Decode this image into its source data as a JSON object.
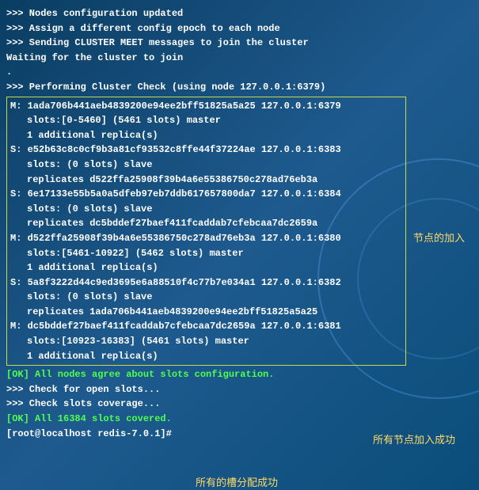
{
  "header": {
    "line1": ">>> Nodes configuration updated",
    "line2": ">>> Assign a different config epoch to each node",
    "line3": ">>> Sending CLUSTER MEET messages to join the cluster",
    "line4": "Waiting for the cluster to join",
    "blank": ".",
    "line5": ">>> Performing Cluster Check (using node 127.0.0.1:6379)"
  },
  "nodes": {
    "n1": {
      "head": "M: 1ada706b441aeb4839200e94ee2bff51825a5a25 127.0.0.1:6379",
      "slots": "slots:[0-5460] (5461 slots) master",
      "extra": "1 additional replica(s)"
    },
    "n2": {
      "head": "S: e52b63c8c0cf9b3a81cf93532c8ffe44f37224ae 127.0.0.1:6383",
      "slots": "slots: (0 slots) slave",
      "extra": "replicates d522ffa25908f39b4a6e55386750c278ad76eb3a"
    },
    "n3": {
      "head": "S: 6e17133e55b5a0a5dfeb97eb7ddb617657800da7 127.0.0.1:6384",
      "slots": "slots: (0 slots) slave",
      "extra": "replicates dc5bddef27baef411fcaddab7cfebcaa7dc2659a"
    },
    "n4": {
      "head": "M: d522ffa25908f39b4a6e55386750c278ad76eb3a 127.0.0.1:6380",
      "slots": "slots:[5461-10922] (5462 slots) master",
      "extra": "1 additional replica(s)"
    },
    "n5": {
      "head": "S: 5a8f3222d44c9ed3695e6a88510f4c77b7e034a1 127.0.0.1:6382",
      "slots": "slots: (0 slots) slave",
      "extra": "replicates 1ada706b441aeb4839200e94ee2bff51825a5a25"
    },
    "n6": {
      "head": "M: dc5bddef27baef411fcaddab7cfebcaa7dc2659a 127.0.0.1:6381",
      "slots": "slots:[10923-16383] (5461 slots) master",
      "extra": "1 additional replica(s)"
    }
  },
  "footer": {
    "ok1": "[OK] All nodes agree about slots configuration.",
    "check1": ">>> Check for open slots...",
    "check2": ">>> Check slots coverage...",
    "ok2": "[OK] All 16384 slots covered.",
    "prompt": "[root@localhost redis-7.0.1]#"
  },
  "annotations": {
    "a1": "节点的加入",
    "a2": "所有节点加入成功",
    "a3": "所有的槽分配成功"
  }
}
